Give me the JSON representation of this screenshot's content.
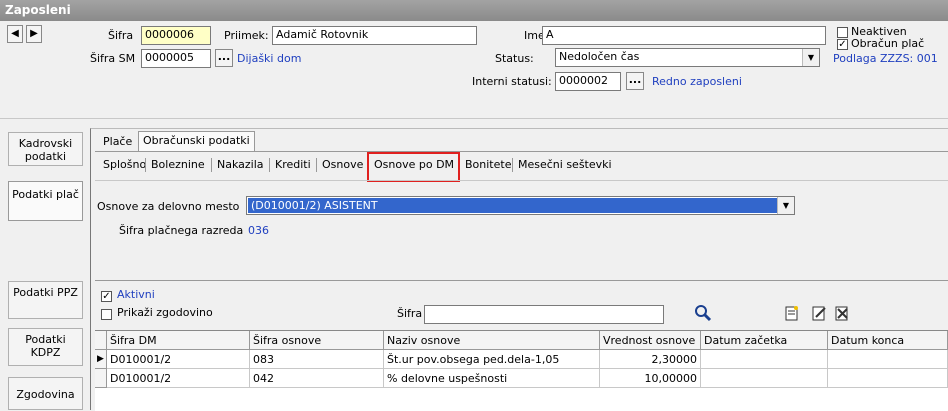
{
  "window": {
    "title": "Zaposleni"
  },
  "nav": {
    "prev": "◀",
    "next": "▶"
  },
  "header": {
    "sifra_label": "Šifra",
    "sifra_value": "0000006",
    "priimek_label": "Priimek:",
    "priimek_value": "Adamič Rotovnik",
    "ime_label": "Ime:",
    "ime_value": "A",
    "sifra_sm_label": "Šifra SM",
    "sifra_sm_value": "0000005",
    "sifra_sm_text": "Dijaški dom",
    "status_label": "Status:",
    "status_value": "Nedoločen čas",
    "interni_label": "Interni statusi:",
    "interni_value": "0000002",
    "interni_text": "Redno zaposleni",
    "neaktiven_label": "Neaktiven",
    "obracun_label": "Obračun plač",
    "podlaga_link": "Podlaga ZZZS: 001",
    "dots": "..."
  },
  "sidebar": {
    "items": [
      "Kadrovski podatki",
      "Podatki plač",
      "Podatki PPZ",
      "Podatki KDPZ",
      "Zgodovina"
    ]
  },
  "tabs_top": [
    "Plače",
    "Obračunski podatki"
  ],
  "subtabs": [
    "Splošno",
    "Boleznine",
    "Nakazila",
    "Krediti",
    "Osnove",
    "Osnove po DM",
    "Bonitete",
    "Mesečni seštevki"
  ],
  "form": {
    "osnove_label": "Osnove  za delovno mesto",
    "osnove_value": "(D010001/2) ASISTENT",
    "razred_label": "Šifra plačnega razreda",
    "razred_value": "036"
  },
  "filters": {
    "aktivni_label": "Aktivni",
    "zgodovino_label": "Prikaži zgodovino",
    "sifra_label": "Šifra",
    "sifra_value": ""
  },
  "table": {
    "headers": [
      "Šifra DM",
      "Šifra osnove",
      "Naziv osnove",
      "Vrednost osnove",
      "Datum začetka",
      "Datum konca"
    ],
    "rows": [
      [
        "D010001/2",
        "083",
        "Št.ur pov.obsega ped.dela-1,05",
        "2,30000",
        "",
        ""
      ],
      [
        "D010001/2",
        "042",
        "% delovne  uspešnosti",
        "10,00000",
        "",
        ""
      ]
    ]
  },
  "colors": {
    "title_bg": "#999999",
    "selection": "#3366cc",
    "highlight_border": "#e0201f",
    "link": "#1f3fbf"
  }
}
